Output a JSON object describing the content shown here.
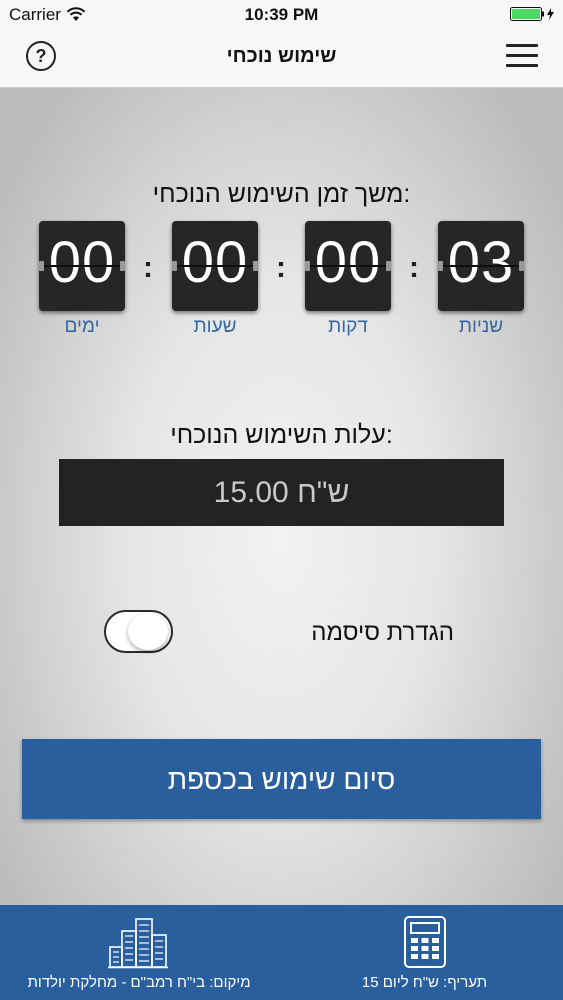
{
  "status_bar": {
    "carrier": "Carrier",
    "time": "10:39 PM"
  },
  "nav": {
    "title": "שימוש נוכחי",
    "help_label": "?"
  },
  "timer": {
    "title": "משך זמן השימוש הנוכחי:",
    "separator": ":",
    "units": [
      {
        "label": "ימים",
        "value": "00"
      },
      {
        "label": "שעות",
        "value": "00"
      },
      {
        "label": "דקות",
        "value": "00"
      },
      {
        "label": "שניות",
        "value": "03"
      }
    ]
  },
  "cost": {
    "title": "עלות השימוש הנוכחי:",
    "value": "15.00 ש\"ח"
  },
  "password": {
    "label": "הגדרת סיסמה",
    "toggle_on": false
  },
  "finish_button": {
    "label": "סיום שימוש בכספת"
  },
  "bottom_bar": {
    "location_text": "מיקום: בי\"ח רמב\"ם - מחלקת יולדות",
    "rate_text": "תעריף: ש\"ח ליום 15",
    "location_icon": "buildings-icon",
    "rate_icon": "calculator-icon"
  },
  "colors": {
    "accent": "#2a5f9e",
    "unit_label": "#35679e",
    "battery": "#4cd964"
  }
}
